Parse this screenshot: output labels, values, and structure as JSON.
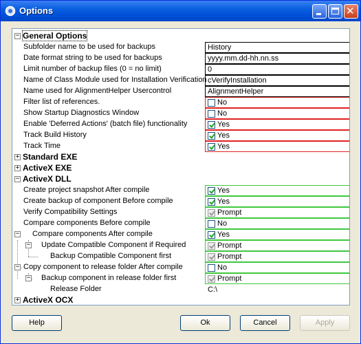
{
  "window": {
    "title": "Options"
  },
  "categories": {
    "general": "General Options",
    "standard_exe": "Standard EXE",
    "activex_exe": "ActiveX EXE",
    "activex_dll": "ActiveX DLL",
    "activex_ocx": "ActiveX OCX"
  },
  "general": {
    "rows": [
      {
        "label": "Subfolder name to be used for backups",
        "value": "History"
      },
      {
        "label": "Date format string to be used for backups",
        "value": "yyyy.mm.dd-hh.nn.ss"
      },
      {
        "label": "Limit number of backup files (0 = no limit)",
        "value": "0"
      },
      {
        "label": "Name of Class Module used for Installation Verification",
        "value": "cVerifyInstallation"
      },
      {
        "label": "Name used for AlignmentHelper Usercontrol",
        "value": "AlignmentHelper"
      },
      {
        "label": "Filter list of references.",
        "value": "No"
      },
      {
        "label": "Show Startup Diagnostics Window",
        "value": "No"
      },
      {
        "label": "Enable 'Deferred Actions' (batch file) functionality",
        "value": "Yes"
      },
      {
        "label": "Track Build History",
        "value": "Yes"
      },
      {
        "label": "Track Time",
        "value": "Yes"
      }
    ]
  },
  "dll": {
    "rows": [
      {
        "label": "Create project snapshot After compile",
        "value": "Yes"
      },
      {
        "label": "Create backup of component Before compile",
        "value": "Yes"
      },
      {
        "label": "Verify Compatibility Settings",
        "value": "Prompt"
      },
      {
        "label": "Compare components Before compile",
        "value": "No"
      },
      {
        "label": "Compare components After compile",
        "value": "Yes"
      },
      {
        "label": "Update Compatible Component if Required",
        "value": "Prompt"
      },
      {
        "label": "Backup Compatible Component first",
        "value": "Prompt"
      },
      {
        "label": "Copy component to release folder After compile",
        "value": "No"
      },
      {
        "label": "Backup component in release folder first",
        "value": "Prompt"
      },
      {
        "label": "Release Folder",
        "value": "C:\\"
      }
    ]
  },
  "buttons": {
    "help": "Help",
    "ok": "Ok",
    "cancel": "Cancel",
    "apply": "Apply"
  },
  "colors": {
    "title_bar": "#0a5fe0",
    "general_border": "#e02020",
    "dll_border": "#3ec83e",
    "checkmark": "#21a121"
  }
}
